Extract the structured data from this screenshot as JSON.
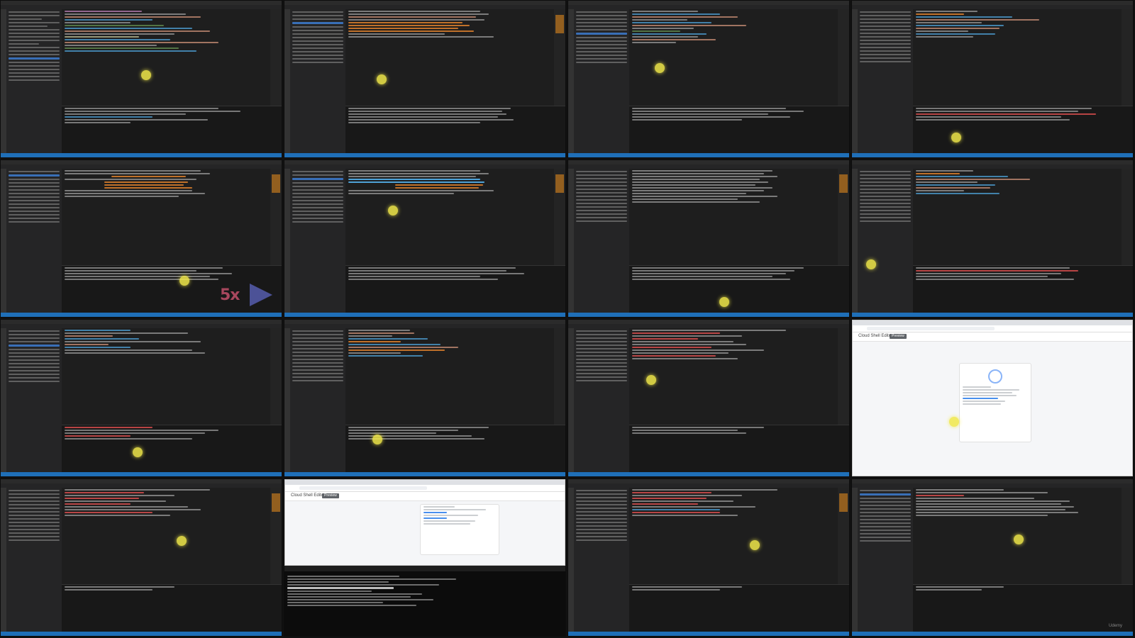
{
  "screen": {
    "tile_count": 16,
    "tile_kinds": [
      "vscode-editor",
      "vscode-editor",
      "vscode-editor",
      "vscode-editor",
      "vscode-editor",
      "vscode-editor",
      "vscode-editor",
      "vscode-editor",
      "vscode-editor",
      "vscode-editor",
      "vscode-editor",
      "browser-cloud-shell",
      "vscode-editor",
      "browser-and-terminal",
      "vscode-editor",
      "vscode-editor"
    ]
  },
  "playback": {
    "speed_label": "5x",
    "speed_icon": "fast-forward-icon"
  },
  "cloud_shell": {
    "title": "Cloud Shell Editor",
    "badge": "Preview"
  },
  "watermark": "Udemy",
  "colors": {
    "editor_bg": "#1e1e1e",
    "status_bar": "#1f6fb8",
    "highlight": "#d27a2b",
    "cursor_highlight": "#f1e84a",
    "speed_label": "#c2506a"
  }
}
